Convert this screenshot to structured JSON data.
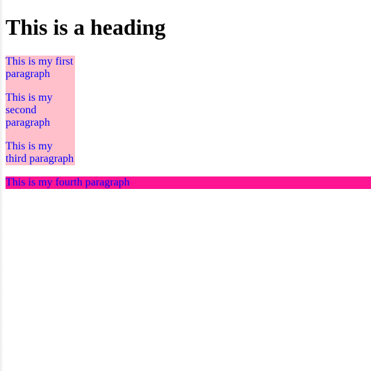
{
  "heading": "This is a heading",
  "paragraphs": [
    "This is my first paragraph",
    "This is my second paragraph",
    "This is my third paragraph",
    "This is my fourth paragraph"
  ],
  "colors": {
    "paragraph_background": "#ffc0cb",
    "fourth_background": "#ff1493",
    "paragraph_text": "#0000ff",
    "heading_text": "#000000"
  }
}
